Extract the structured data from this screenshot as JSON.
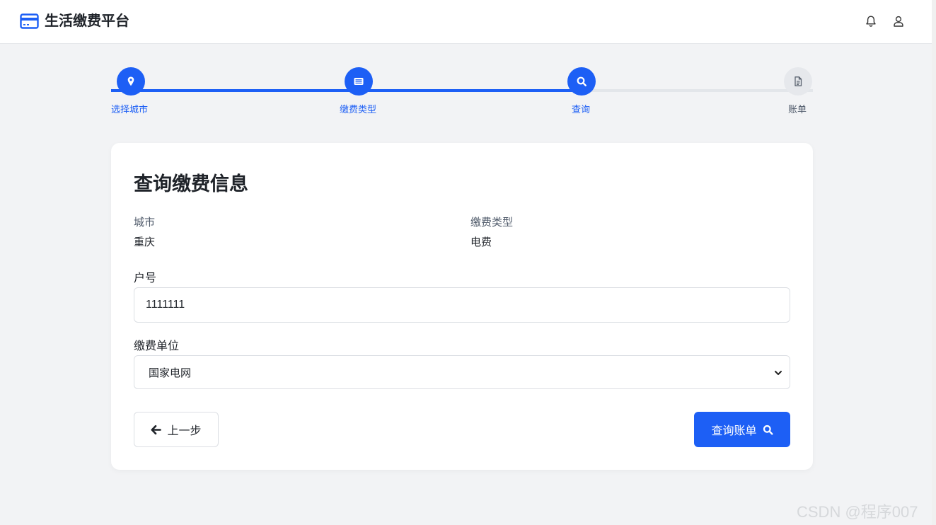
{
  "header": {
    "title": "生活缴费平台",
    "brand_icon": "credit-card-icon",
    "actions": [
      "bell-icon",
      "user-icon"
    ]
  },
  "steps": [
    {
      "label": "选择城市",
      "icon": "map-marker-icon",
      "state": "done"
    },
    {
      "label": "缴费类型",
      "icon": "list-card-icon",
      "state": "done"
    },
    {
      "label": "查询",
      "icon": "search-icon",
      "state": "current"
    },
    {
      "label": "账单",
      "icon": "document-icon",
      "state": "pending"
    }
  ],
  "card": {
    "title": "查询缴费信息",
    "city_label": "城市",
    "city_value": "重庆",
    "type_label": "缴费类型",
    "type_value": "电费",
    "account_label": "户号",
    "account_value": "1111111",
    "unit_label": "缴费单位",
    "unit_value": "国家电网",
    "back_button": "上一步",
    "query_button": "查询账单"
  },
  "watermark": "CSDN @程序007",
  "colors": {
    "accent": "#1d5ff5",
    "background": "#f2f3f5",
    "inactive": "#e6e8ec"
  }
}
